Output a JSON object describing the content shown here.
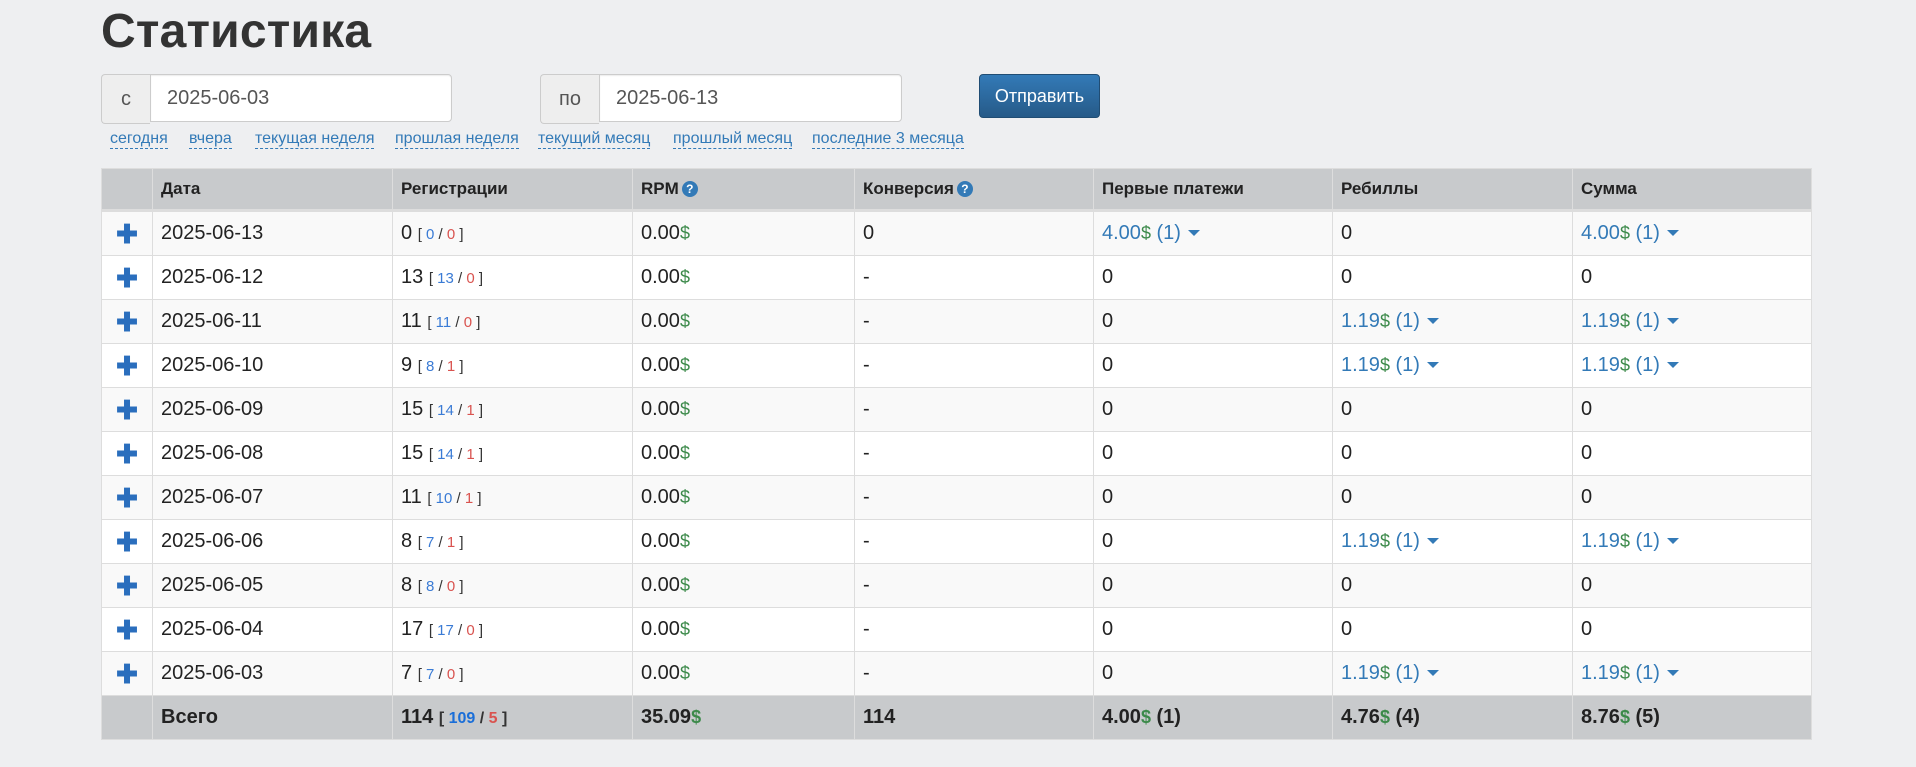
{
  "page": {
    "title": "Статистика"
  },
  "filters": {
    "from_label": "с",
    "from_value": "2025-06-03",
    "to_label": "по",
    "to_value": "2025-06-13",
    "submit_label": "Отправить",
    "quick_links": [
      "сегодня",
      "вчера",
      "текущая неделя",
      "прошлая неделя",
      "текущий месяц",
      "прошлый месяц",
      "последние 3 месяца"
    ]
  },
  "table": {
    "headers": [
      "",
      "Дата",
      "Регистрации",
      "RPM",
      "Конверсия",
      "Первые платежи",
      "Ребиллы",
      "Сумма"
    ],
    "help_glyph": "?",
    "expand_glyph": "✚",
    "currency": "$",
    "rows": [
      {
        "date": "2025-06-13",
        "reg_total": "0",
        "reg_a": "0",
        "reg_b": "0",
        "rpm": "0.00",
        "conv": "0",
        "first": {
          "amount": "4.00",
          "count": "(1)"
        },
        "rebills": {
          "plain": "0"
        },
        "sum": {
          "amount": "4.00",
          "count": "(1)"
        }
      },
      {
        "date": "2025-06-12",
        "reg_total": "13",
        "reg_a": "13",
        "reg_b": "0",
        "rpm": "0.00",
        "conv": "-",
        "first": {
          "plain": "0"
        },
        "rebills": {
          "plain": "0"
        },
        "sum": {
          "plain": "0"
        }
      },
      {
        "date": "2025-06-11",
        "reg_total": "11",
        "reg_a": "11",
        "reg_b": "0",
        "rpm": "0.00",
        "conv": "-",
        "first": {
          "plain": "0"
        },
        "rebills": {
          "amount": "1.19",
          "count": "(1)"
        },
        "sum": {
          "amount": "1.19",
          "count": "(1)"
        }
      },
      {
        "date": "2025-06-10",
        "reg_total": "9",
        "reg_a": "8",
        "reg_b": "1",
        "rpm": "0.00",
        "conv": "-",
        "first": {
          "plain": "0"
        },
        "rebills": {
          "amount": "1.19",
          "count": "(1)"
        },
        "sum": {
          "amount": "1.19",
          "count": "(1)"
        }
      },
      {
        "date": "2025-06-09",
        "reg_total": "15",
        "reg_a": "14",
        "reg_b": "1",
        "rpm": "0.00",
        "conv": "-",
        "first": {
          "plain": "0"
        },
        "rebills": {
          "plain": "0"
        },
        "sum": {
          "plain": "0"
        }
      },
      {
        "date": "2025-06-08",
        "reg_total": "15",
        "reg_a": "14",
        "reg_b": "1",
        "rpm": "0.00",
        "conv": "-",
        "first": {
          "plain": "0"
        },
        "rebills": {
          "plain": "0"
        },
        "sum": {
          "plain": "0"
        }
      },
      {
        "date": "2025-06-07",
        "reg_total": "11",
        "reg_a": "10",
        "reg_b": "1",
        "rpm": "0.00",
        "conv": "-",
        "first": {
          "plain": "0"
        },
        "rebills": {
          "plain": "0"
        },
        "sum": {
          "plain": "0"
        }
      },
      {
        "date": "2025-06-06",
        "reg_total": "8",
        "reg_a": "7",
        "reg_b": "1",
        "rpm": "0.00",
        "conv": "-",
        "first": {
          "plain": "0"
        },
        "rebills": {
          "amount": "1.19",
          "count": "(1)"
        },
        "sum": {
          "amount": "1.19",
          "count": "(1)"
        }
      },
      {
        "date": "2025-06-05",
        "reg_total": "8",
        "reg_a": "8",
        "reg_b": "0",
        "rpm": "0.00",
        "conv": "-",
        "first": {
          "plain": "0"
        },
        "rebills": {
          "plain": "0"
        },
        "sum": {
          "plain": "0"
        }
      },
      {
        "date": "2025-06-04",
        "reg_total": "17",
        "reg_a": "17",
        "reg_b": "0",
        "rpm": "0.00",
        "conv": "-",
        "first": {
          "plain": "0"
        },
        "rebills": {
          "plain": "0"
        },
        "sum": {
          "plain": "0"
        }
      },
      {
        "date": "2025-06-03",
        "reg_total": "7",
        "reg_a": "7",
        "reg_b": "0",
        "rpm": "0.00",
        "conv": "-",
        "first": {
          "plain": "0"
        },
        "rebills": {
          "amount": "1.19",
          "count": "(1)"
        },
        "sum": {
          "amount": "1.19",
          "count": "(1)"
        }
      }
    ],
    "total": {
      "label": "Всего",
      "reg_total": "114",
      "reg_a": "109",
      "reg_b": "5",
      "rpm": "35.09",
      "conv": "114",
      "first": {
        "amount": "4.00",
        "count": "(1)"
      },
      "rebills": {
        "amount": "4.76",
        "count": "(4)"
      },
      "sum": {
        "amount": "8.76",
        "count": "(5)"
      }
    }
  }
}
